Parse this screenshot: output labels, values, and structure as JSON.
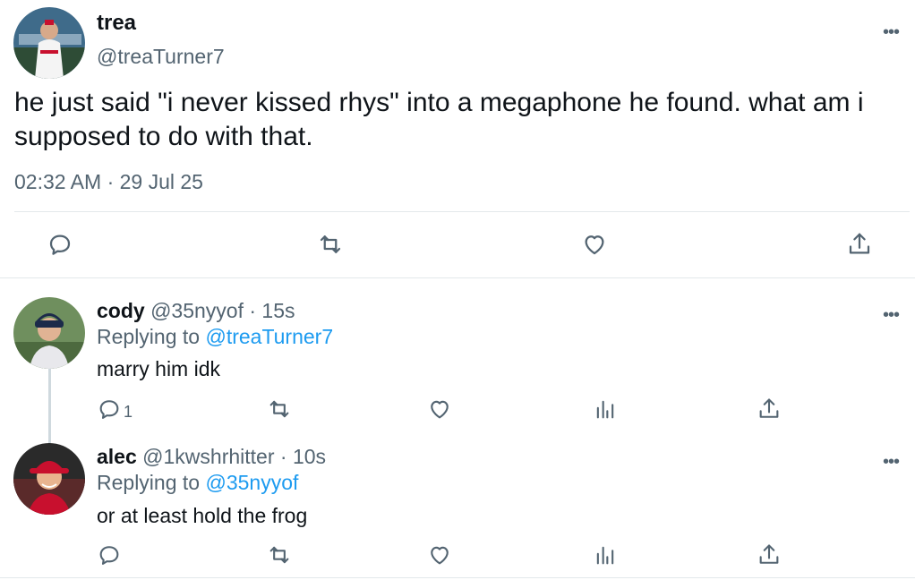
{
  "main": {
    "name": "trea",
    "handle": "@treaTurner7",
    "text": "he just said \"i never kissed rhys\" into a megaphone he found. what am i supposed to do with that.",
    "timestamp": "02:32 AM · 29 Jul 25",
    "more": "•••"
  },
  "replies": [
    {
      "name": "cody",
      "handle": "@35nyyof",
      "time": "· 15s",
      "replying_prefix": "Replying to",
      "replying_to": "@treaTurner7",
      "text": "marry him idk",
      "reply_count": "1",
      "more": "•••"
    },
    {
      "name": "alec",
      "handle": "@1kwshrhitter",
      "time": "· 10s",
      "replying_prefix": "Replying to",
      "replying_to": "@35nyyof",
      "text": "or at least hold the frog",
      "reply_count": "",
      "more": "•••"
    }
  ],
  "icons": {
    "reply": "reply-icon",
    "retweet": "retweet-icon",
    "like": "heart-icon",
    "share": "share-icon",
    "views": "views-icon"
  },
  "colors": {
    "text": "#0f1419",
    "muted": "#536471",
    "link": "#1d9bf0",
    "divider": "#e3e8eb"
  }
}
